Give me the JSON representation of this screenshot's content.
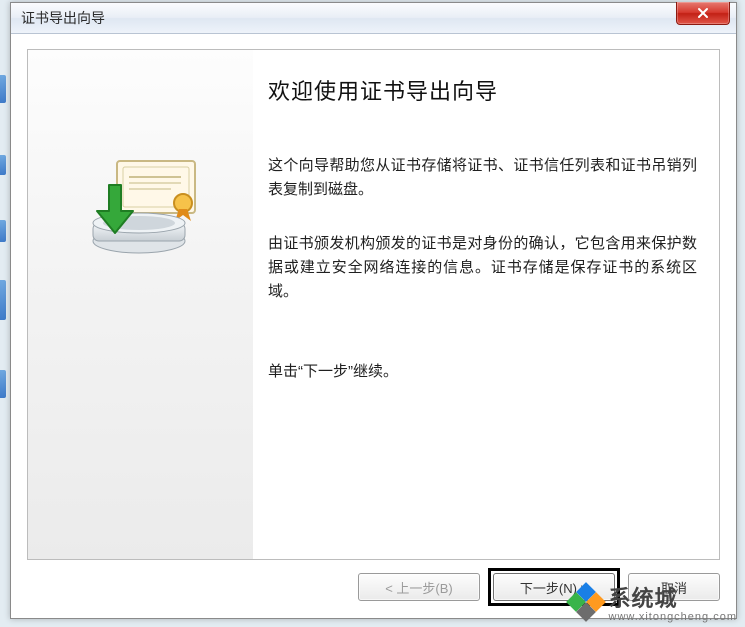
{
  "window": {
    "title": "证书导出向导"
  },
  "content": {
    "heading": "欢迎使用证书导出向导",
    "para1": "这个向导帮助您从证书存储将证书、证书信任列表和证书吊销列表复制到磁盘。",
    "para2": "由证书颁发机构颁发的证书是对身份的确认，它包含用来保护数据或建立安全网络连接的信息。证书存储是保存证书的系统区域。",
    "para3": "单击“下一步”继续。"
  },
  "buttons": {
    "back": "< 上一步(B)",
    "next": "下一步(N) >",
    "cancel": "取消"
  },
  "watermark": {
    "cn": "系统城",
    "en": "www.xitongcheng.com"
  }
}
